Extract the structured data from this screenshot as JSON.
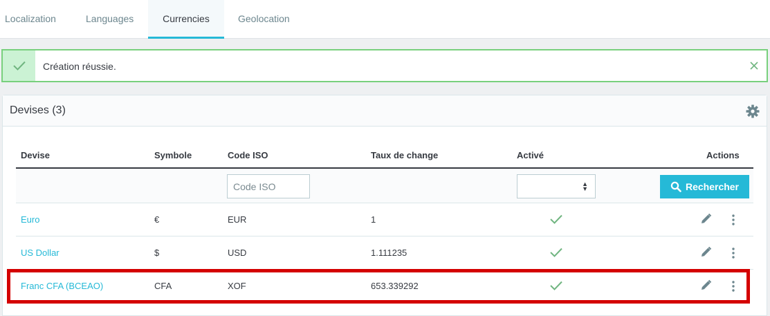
{
  "tabs": [
    {
      "label": "Localization",
      "active": false
    },
    {
      "label": "Languages",
      "active": false
    },
    {
      "label": "Currencies",
      "active": true
    },
    {
      "label": "Geolocation",
      "active": false
    }
  ],
  "alert": {
    "message": "Création réussie.",
    "icon": "check-icon",
    "close_icon": "close-icon",
    "border_color": "#78d07d"
  },
  "card": {
    "title": "Devises (3)",
    "settings_icon": "gear-icon"
  },
  "table": {
    "headers": {
      "currency": "Devise",
      "symbol": "Symbole",
      "iso": "Code ISO",
      "rate": "Taux de change",
      "active": "Activé",
      "actions": "Actions"
    },
    "filters": {
      "iso_placeholder": "Code ISO",
      "active_value": "",
      "search_label": "Rechercher"
    },
    "rows": [
      {
        "name": "Euro",
        "symbol": "€",
        "iso": "EUR",
        "rate": "1",
        "active": true
      },
      {
        "name": "US Dollar",
        "symbol": "$",
        "iso": "USD",
        "rate": "1.111235",
        "active": true
      },
      {
        "name": "Franc CFA (BCEAO)",
        "symbol": "CFA",
        "iso": "XOF",
        "rate": "653.339292",
        "active": true
      }
    ]
  },
  "colors": {
    "accent": "#25b9d7",
    "success": "#70b580",
    "highlight": "#d40000"
  }
}
